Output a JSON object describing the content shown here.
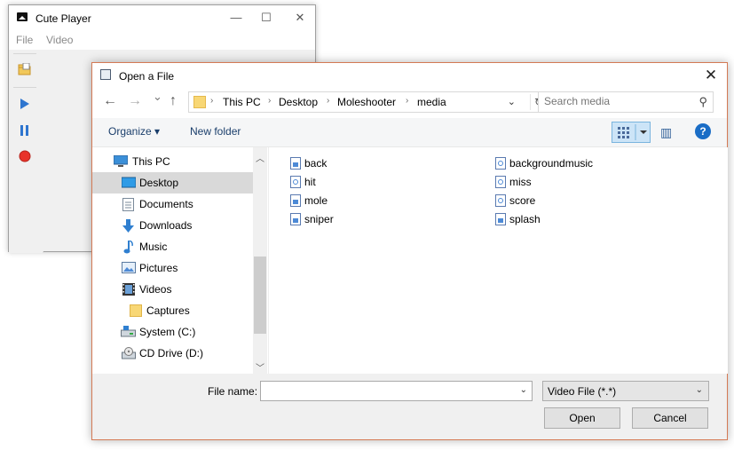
{
  "player": {
    "title": "Cute Player",
    "menu": [
      "File",
      "Video"
    ],
    "controls": {
      "minimize": "—",
      "maximize": "☐",
      "close": "✕"
    },
    "toolbar_colors": {
      "play": "#2e75cf",
      "pause": "#2e75cf",
      "record": "#e8332a",
      "open": "#e8b84a"
    }
  },
  "dialog": {
    "title": "Open a File",
    "close": "✕",
    "nav": {
      "back": "←",
      "forward": "→",
      "recent": "⌄",
      "up": "↑"
    },
    "breadcrumb": [
      "This PC",
      "Desktop",
      "Moleshooter",
      "media"
    ],
    "crumb_sep": "›",
    "search_placeholder": "Search media",
    "commands": {
      "organize": "Organize ▾",
      "new_folder": "New folder"
    },
    "help": "?",
    "nav_pane": [
      {
        "label": "This PC",
        "icon": "pc-icon"
      },
      {
        "label": "Desktop",
        "icon": "desktop-icon",
        "selected": true
      },
      {
        "label": "Documents",
        "icon": "documents-icon"
      },
      {
        "label": "Downloads",
        "icon": "downloads-icon"
      },
      {
        "label": "Music",
        "icon": "music-icon"
      },
      {
        "label": "Pictures",
        "icon": "pictures-icon"
      },
      {
        "label": "Videos",
        "icon": "videos-icon"
      },
      {
        "label": "Captures",
        "icon": "folder-icon"
      },
      {
        "label": "System (C:)",
        "icon": "drive-icon"
      },
      {
        "label": "CD Drive (D:)",
        "icon": "cd-icon"
      }
    ],
    "files_left": [
      {
        "name": "back",
        "kind": "pic"
      },
      {
        "name": "hit",
        "kind": "snd"
      },
      {
        "name": "mole",
        "kind": "pic"
      },
      {
        "name": "sniper",
        "kind": "pic"
      }
    ],
    "files_right": [
      {
        "name": "backgroundmusic",
        "kind": "snd"
      },
      {
        "name": "miss",
        "kind": "snd"
      },
      {
        "name": "score",
        "kind": "snd"
      },
      {
        "name": "splash",
        "kind": "pic"
      }
    ],
    "file_name_label": "File name:",
    "file_name_value": "",
    "file_type": "Video File (*.*)",
    "open_label": "Open",
    "cancel_label": "Cancel"
  }
}
